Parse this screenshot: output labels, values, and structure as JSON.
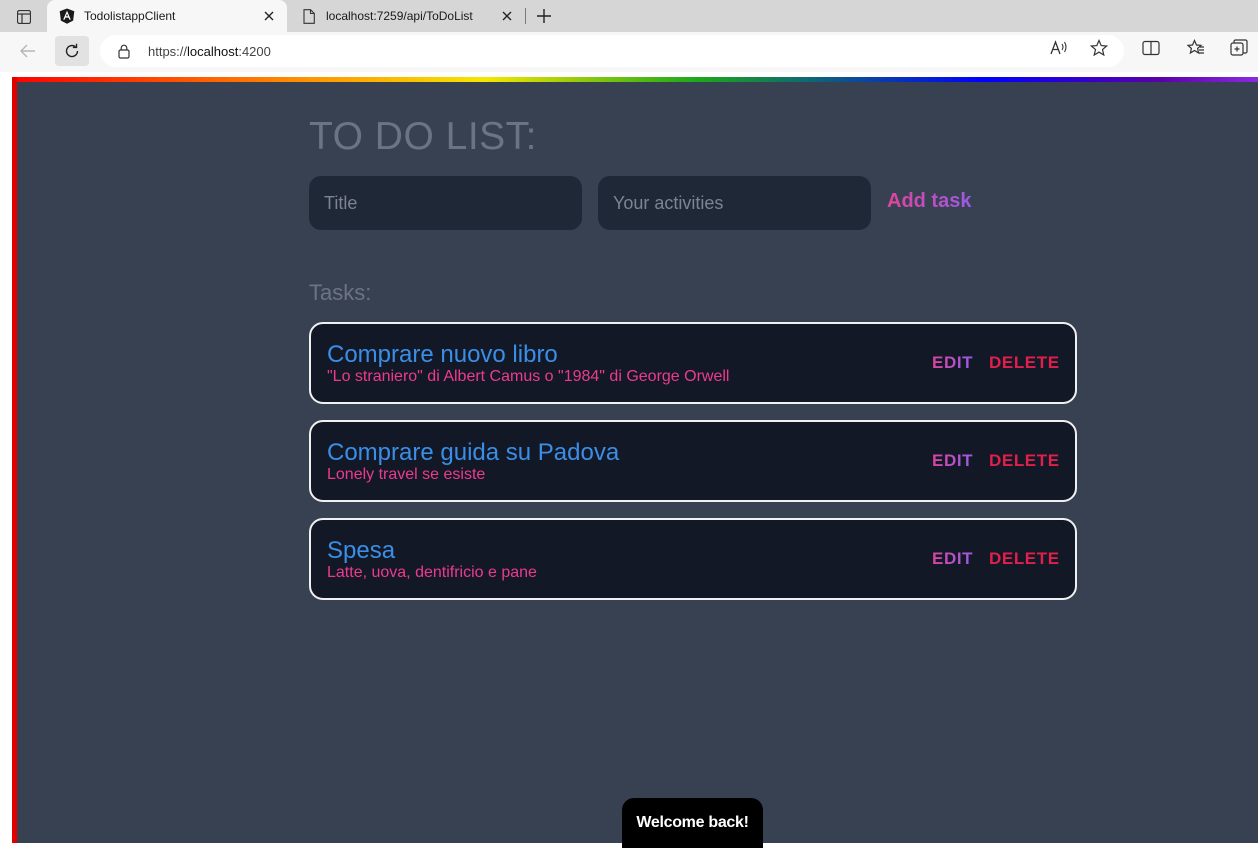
{
  "browser": {
    "tabs": [
      {
        "title": "TodolistappClient",
        "icon": "angular-logo-icon",
        "active": true
      },
      {
        "title": "localhost:7259/api/ToDoList",
        "icon": "page-icon",
        "active": false
      }
    ],
    "address": {
      "scheme": "https://",
      "host": "localhost",
      "port": ":4200"
    }
  },
  "app": {
    "heading": "TO DO LIST:",
    "form": {
      "title_placeholder": "Title",
      "activities_placeholder": "Your activities",
      "add_label": "Add task"
    },
    "tasks_label": "Tasks:",
    "tasks": [
      {
        "title": "Comprare nuovo libro",
        "description": "\"Lo straniero\" di Albert Camus o \"1984\" di George Orwell",
        "edit_label": "EDIT",
        "delete_label": "DELETE"
      },
      {
        "title": "Comprare guida su Padova",
        "description": "Lonely travel se esiste",
        "edit_label": "EDIT",
        "delete_label": "DELETE"
      },
      {
        "title": "Spesa",
        "description": "Latte, uova, dentifricio e pane",
        "edit_label": "EDIT",
        "delete_label": "DELETE"
      }
    ],
    "toast": "Welcome back!"
  },
  "colors": {
    "app_background": "#384152",
    "card_background": "#131827",
    "task_title": "#3a8ee6",
    "task_description": "#ec3b8e",
    "delete": "#e01f4b"
  }
}
